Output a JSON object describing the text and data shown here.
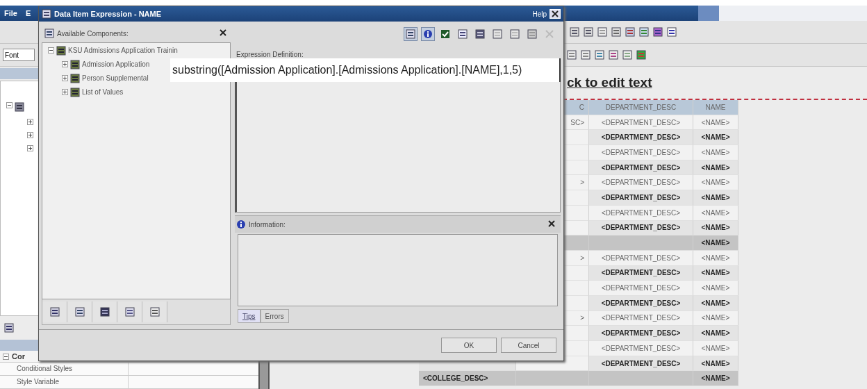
{
  "app": {
    "menu": [
      "File",
      "E"
    ],
    "font_field": {
      "value": "Font"
    },
    "report_heading": "ck to edit text",
    "table": {
      "columns": [
        "C",
        "DEPARTMENT_DESC",
        "NAME"
      ],
      "rows": [
        {
          "kind": "detail",
          "column_2": "SC>",
          "department_desc": "<DEPARTMENT_DESC>",
          "name": "<NAME>"
        },
        {
          "kind": "total",
          "department_desc": "<DEPARTMENT_DESC>",
          "name": "<NAME>"
        },
        {
          "kind": "detail",
          "department_desc": "<DEPARTMENT_DESC>",
          "name": "<NAME>"
        },
        {
          "kind": "total",
          "department_desc": "<DEPARTMENT_DESC>",
          "name": "<NAME>"
        },
        {
          "kind": "detail",
          "column_2": ">",
          "department_desc": "<DEPARTMENT_DESC>",
          "name": "<NAME>"
        },
        {
          "kind": "total",
          "department_desc": "<DEPARTMENT_DESC>",
          "name": "<NAME>"
        },
        {
          "kind": "detail",
          "department_desc": "<DEPARTMENT_DESC>",
          "name": "<NAME>"
        },
        {
          "kind": "total",
          "department_desc": "<DEPARTMENT_DESC>",
          "name": "<NAME>"
        },
        {
          "kind": "group",
          "name": "<NAME>"
        },
        {
          "kind": "detail",
          "column_2": ">",
          "department_desc": "<DEPARTMENT_DESC>",
          "name": "<NAME>"
        },
        {
          "kind": "total",
          "department_desc": "<DEPARTMENT_DESC>",
          "name": "<NAME>"
        },
        {
          "kind": "detail",
          "department_desc": "<DEPARTMENT_DESC>",
          "name": "<NAME>"
        },
        {
          "kind": "total",
          "department_desc": "<DEPARTMENT_DESC>",
          "name": "<NAME>"
        },
        {
          "kind": "detail",
          "column_2": ">",
          "department_desc": "<DEPARTMENT_DESC>",
          "name": "<NAME>"
        },
        {
          "kind": "total",
          "department_desc": "<DEPARTMENT_DESC>",
          "name": "<NAME>"
        },
        {
          "kind": "detail",
          "department_desc": "<DEPARTMENT_DESC>",
          "name": "<NAME>"
        },
        {
          "kind": "total",
          "department_desc": "<DEPARTMENT_DESC>",
          "name": "<NAME>"
        },
        {
          "kind": "footer",
          "column_1": "<COLLEGE_DESC>",
          "name": "<NAME>"
        }
      ]
    },
    "properties": {
      "group": {
        "label": "Cor",
        "expanded": true
      },
      "rows": [
        "Conditional Styles",
        "Style Variable"
      ]
    }
  },
  "dialog": {
    "title": "Data Item Expression - NAME",
    "help": "Help",
    "components": {
      "title": "Available Components:",
      "tree": [
        {
          "label": "KSU Admissions Application Trainin",
          "expanded": true,
          "children": [
            {
              "label": "Admission Application",
              "expanded": false
            },
            {
              "label": "Person Supplemental",
              "expanded": false
            },
            {
              "label": "List of Values",
              "expanded": false
            }
          ]
        }
      ]
    },
    "expression_label": "Expression Definition:",
    "information_title": "Information:",
    "info_tabs": [
      {
        "label": "Tips",
        "selected": true
      },
      {
        "label": "Errors",
        "selected": false
      }
    ],
    "buttons": [
      "OK",
      "Cancel"
    ]
  },
  "overlay_text": "substring([Admission Application].[Admissions Application].[NAME],1,5)"
}
